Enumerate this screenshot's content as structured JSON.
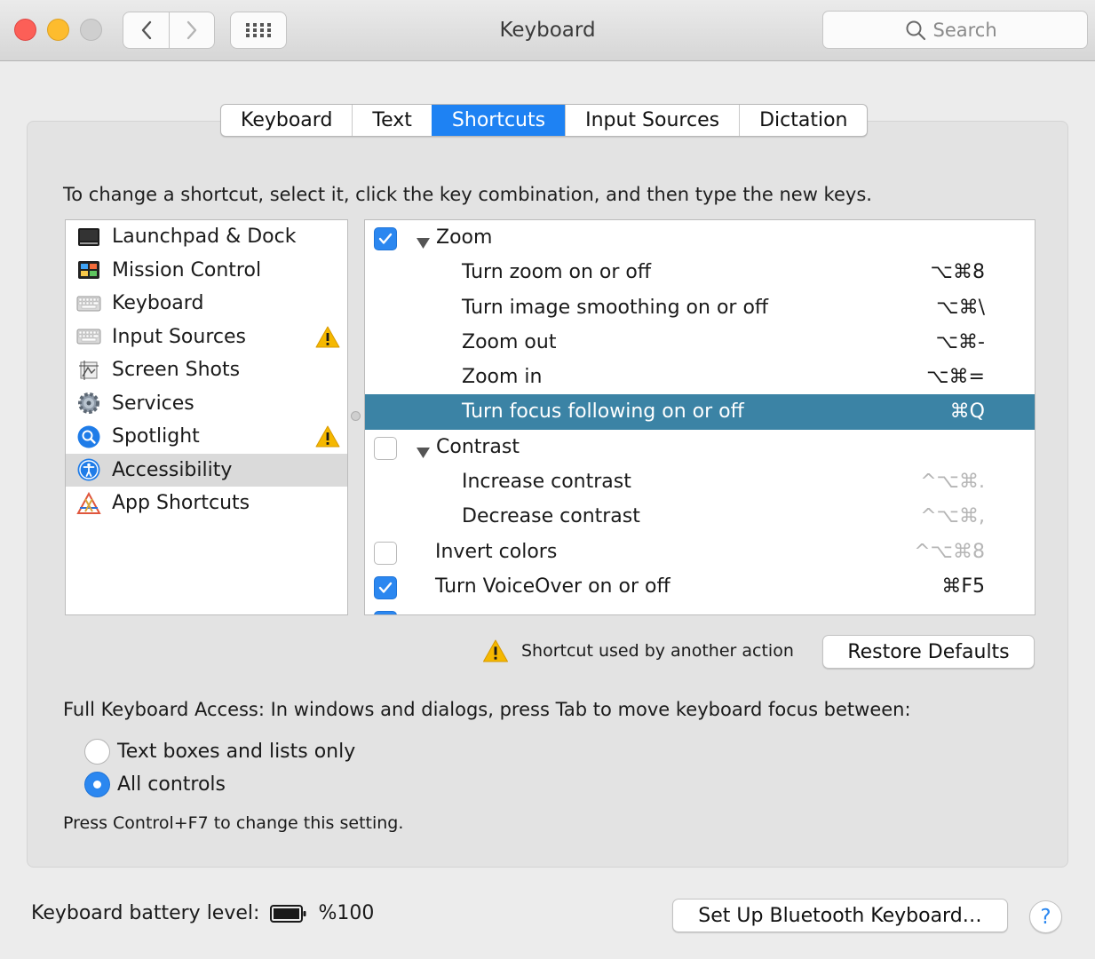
{
  "window": {
    "title": "Keyboard",
    "search_placeholder": "Search"
  },
  "tabs": [
    {
      "label": "Keyboard",
      "active": false
    },
    {
      "label": "Text",
      "active": false
    },
    {
      "label": "Shortcuts",
      "active": true
    },
    {
      "label": "Input Sources",
      "active": false
    },
    {
      "label": "Dictation",
      "active": false
    }
  ],
  "instructions": "To change a shortcut, select it, click the key combination, and then type the new keys.",
  "categories": [
    {
      "label": "Launchpad & Dock",
      "icon": "launchpad-dock-icon",
      "warning": false
    },
    {
      "label": "Mission Control",
      "icon": "mission-control-icon",
      "warning": false
    },
    {
      "label": "Keyboard",
      "icon": "keyboard-icon",
      "warning": false
    },
    {
      "label": "Input Sources",
      "icon": "input-sources-icon",
      "warning": true
    },
    {
      "label": "Screen Shots",
      "icon": "screenshot-icon",
      "warning": false
    },
    {
      "label": "Services",
      "icon": "services-gear-icon",
      "warning": false
    },
    {
      "label": "Spotlight",
      "icon": "spotlight-icon",
      "warning": true
    },
    {
      "label": "Accessibility",
      "icon": "accessibility-icon",
      "warning": false,
      "selected": true
    },
    {
      "label": "App Shortcuts",
      "icon": "app-shortcuts-icon",
      "warning": false
    }
  ],
  "shortcuts": [
    {
      "label": "Zoom",
      "group": true,
      "checked": true,
      "key": ""
    },
    {
      "label": "Turn zoom on or off",
      "key": "⌥⌘8"
    },
    {
      "label": "Turn image smoothing on or off",
      "key": "⌥⌘\\"
    },
    {
      "label": "Zoom out",
      "key": "⌥⌘-"
    },
    {
      "label": "Zoom in",
      "key": "⌥⌘="
    },
    {
      "label": "Turn focus following on or off",
      "key": "⌘Q",
      "selected": true
    },
    {
      "label": "Contrast",
      "group": true,
      "checked": false,
      "key": ""
    },
    {
      "label": "Increase contrast",
      "key": "^⌥⌘.",
      "dim": true
    },
    {
      "label": "Decrease contrast",
      "key": "^⌥⌘,",
      "dim": true
    },
    {
      "label": "Invert colors",
      "checkbox": true,
      "checked": false,
      "key": "^⌥⌘8",
      "dim": true
    },
    {
      "label": "Turn VoiceOver on or off",
      "checkbox": true,
      "checked": true,
      "key": "⌘F5"
    }
  ],
  "warning_note": "Shortcut used by another action",
  "restore_defaults": "Restore Defaults",
  "full_keyboard_access": "Full Keyboard Access: In windows and dialogs, press Tab to move keyboard focus between:",
  "radio_options": [
    {
      "label": "Text boxes and lists only",
      "selected": false
    },
    {
      "label": "All controls",
      "selected": true
    }
  ],
  "hint": "Press Control+F7 to change this setting.",
  "battery": {
    "label": "Keyboard battery level:",
    "value": "%100"
  },
  "bluetooth_button": "Set Up Bluetooth Keyboard…",
  "help_label": "?",
  "colors": {
    "accent": "#1e82f3",
    "selected_row": "#3b83a5",
    "warning": "#f5b800"
  }
}
